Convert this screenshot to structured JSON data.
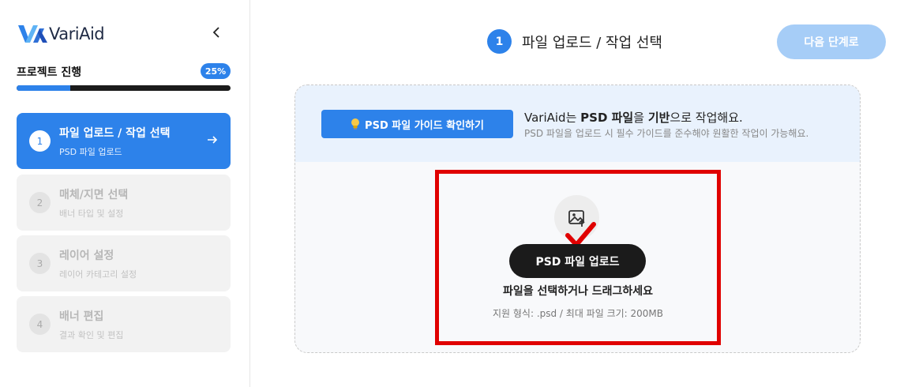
{
  "brand": {
    "name": "VariAid"
  },
  "sidebar": {
    "progress_title": "프로젝트 진행",
    "progress_label": "25%",
    "progress_value": 0.25,
    "steps": [
      {
        "number": "1",
        "title": "파일 업로드 / 작업 선택",
        "subtitle": "PSD 파일 업로드",
        "active": true
      },
      {
        "number": "2",
        "title": "매체/지면 선택",
        "subtitle": "배너 타입 및 설정",
        "active": false
      },
      {
        "number": "3",
        "title": "레이어 설정",
        "subtitle": "레이어 카테고리 설정",
        "active": false
      },
      {
        "number": "4",
        "title": "배너 편집",
        "subtitle": "결과 확인 및 편집",
        "active": false
      }
    ]
  },
  "header": {
    "step_number": "1",
    "step_title": "파일 업로드 / 작업 선택",
    "next_label": "다음 단계로"
  },
  "guide": {
    "button_label": "PSD 파일 가이드 확인하기",
    "line1_prefix": "VariAid는 ",
    "line1_bold1": "PSD 파일",
    "line1_mid": "을 ",
    "line1_bold2": "기반",
    "line1_suffix": "으로 작업해요.",
    "line2": "PSD 파일을 업로드 시 필수 가이드를 준수해야 원활한 작업이 가능해요."
  },
  "upload": {
    "button_label": "PSD 파일 업로드",
    "hint": "파일을 선택하거나 드래그하세요",
    "formats": "지원 형식: .psd / 최대 파일 크기: 200MB"
  },
  "colors": {
    "accent": "#2d82ea",
    "next_disabled": "#a6cdf7",
    "highlight": "#e00000",
    "dark": "#1b1b1b"
  },
  "icons": {
    "logo": "variaid-logo-icon",
    "collapse": "chevron-left-icon",
    "arrow": "arrow-right-icon",
    "bulb": "lightbulb-icon",
    "image_upload": "image-upload-icon",
    "check": "checkmark-icon"
  }
}
